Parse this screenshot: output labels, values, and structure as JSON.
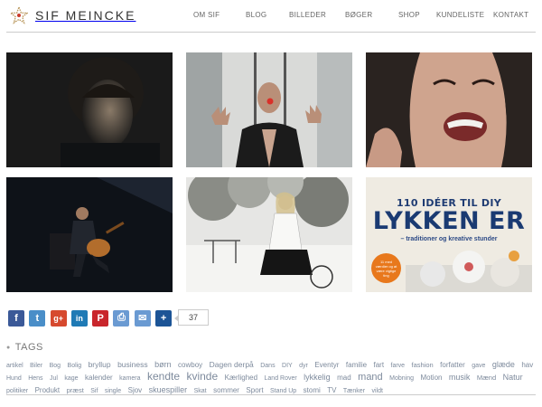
{
  "site": {
    "name": "SIF MEINCKE"
  },
  "nav": [
    "OM SIF",
    "BLOG",
    "BILLEDER",
    "BØGER",
    "SHOP",
    "KUNDELISTE",
    "KONTAKT"
  ],
  "gallery": {
    "book": {
      "line1": "110 IDÉER TIL DIY",
      "line2": "LYKKEN ER",
      "sub": "– traditioner og kreative stunder",
      "badge": "11 med værdier og at være vigtige ting"
    }
  },
  "share": {
    "buttons": [
      {
        "name": "facebook",
        "color": "#3b5998",
        "glyph": "f"
      },
      {
        "name": "twitter",
        "color": "#4a8ec8",
        "glyph": "t"
      },
      {
        "name": "google-plus",
        "color": "#d6492e",
        "glyph": "g+"
      },
      {
        "name": "linkedin",
        "color": "#1f7ab5",
        "glyph": "in"
      },
      {
        "name": "pinterest",
        "color": "#c9262c",
        "glyph": "P"
      },
      {
        "name": "print",
        "color": "#6a9ad2",
        "glyph": "⎙"
      },
      {
        "name": "email",
        "color": "#6a9ad2",
        "glyph": "✉"
      },
      {
        "name": "more",
        "color": "#1c5496",
        "glyph": "+"
      }
    ],
    "count": "37"
  },
  "tags": {
    "heading": "TAGS",
    "items": [
      {
        "t": "artikel",
        "s": 7
      },
      {
        "t": "Biler",
        "s": 7
      },
      {
        "t": "Bog",
        "s": 7
      },
      {
        "t": "Bolig",
        "s": 7
      },
      {
        "t": "bryllup",
        "s": 8.5
      },
      {
        "t": "business",
        "s": 8.5
      },
      {
        "t": "børn",
        "s": 9
      },
      {
        "t": "cowboy",
        "s": 8
      },
      {
        "t": "Dagen derpå",
        "s": 8.5
      },
      {
        "t": "Dans",
        "s": 7
      },
      {
        "t": "DIY",
        "s": 7
      },
      {
        "t": "dyr",
        "s": 7
      },
      {
        "t": "Eventyr",
        "s": 8
      },
      {
        "t": "familie",
        "s": 8
      },
      {
        "t": "fart",
        "s": 8
      },
      {
        "t": "farve",
        "s": 7
      },
      {
        "t": "fashion",
        "s": 7.5
      },
      {
        "t": "forfatter",
        "s": 8
      },
      {
        "t": "gave",
        "s": 7
      },
      {
        "t": "glæde",
        "s": 9
      },
      {
        "t": "hav",
        "s": 8
      },
      {
        "t": "Hund",
        "s": 7
      },
      {
        "t": "Hens",
        "s": 7
      },
      {
        "t": "Jul",
        "s": 7
      },
      {
        "t": "kage",
        "s": 7
      },
      {
        "t": "kalender",
        "s": 8
      },
      {
        "t": "kamera",
        "s": 7
      },
      {
        "t": "kendte",
        "s": 12
      },
      {
        "t": "kvinde",
        "s": 12
      },
      {
        "t": "Kærlighed",
        "s": 8
      },
      {
        "t": "Land Rover",
        "s": 7
      },
      {
        "t": "lykkelig",
        "s": 9
      },
      {
        "t": "mad",
        "s": 8
      },
      {
        "t": "mand",
        "s": 11
      },
      {
        "t": "Mobning",
        "s": 7
      },
      {
        "t": "Motion",
        "s": 8
      },
      {
        "t": "musik",
        "s": 9
      },
      {
        "t": "Mænd",
        "s": 7.5
      },
      {
        "t": "Natur",
        "s": 9
      },
      {
        "t": "politiker",
        "s": 7
      },
      {
        "t": "Produkt",
        "s": 8
      },
      {
        "t": "præst",
        "s": 7.5
      },
      {
        "t": "Sif",
        "s": 7
      },
      {
        "t": "single",
        "s": 7
      },
      {
        "t": "Sjov",
        "s": 8
      },
      {
        "t": "skuespiller",
        "s": 9
      },
      {
        "t": "Skat",
        "s": 7
      },
      {
        "t": "sommer",
        "s": 8
      },
      {
        "t": "Sport",
        "s": 8
      },
      {
        "t": "Stand Up",
        "s": 7
      },
      {
        "t": "stomi",
        "s": 8
      },
      {
        "t": "TV",
        "s": 8
      },
      {
        "t": "Tænker",
        "s": 7
      },
      {
        "t": "vildt",
        "s": 7
      }
    ]
  },
  "footer": {
    "text": ""
  }
}
